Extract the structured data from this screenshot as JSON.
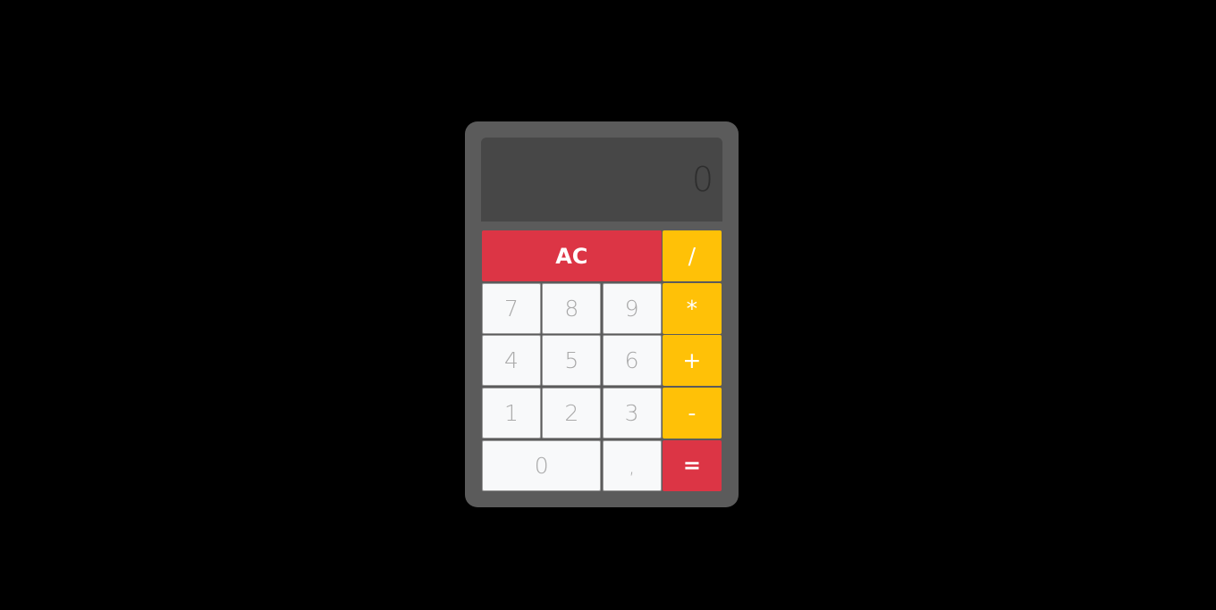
{
  "calculator": {
    "display_value": "0",
    "keys": {
      "clear": "AC",
      "divide": "/",
      "multiply": "*",
      "add": "+",
      "subtract": "-",
      "equals": "=",
      "seven": "7",
      "eight": "8",
      "nine": "9",
      "four": "4",
      "five": "5",
      "six": "6",
      "one": "1",
      "two": "2",
      "three": "3",
      "zero": "0",
      "decimal": ","
    }
  },
  "colors": {
    "background": "#000000",
    "body": "#5b5b5b",
    "display": "#474747",
    "number_key": "#f8f9fa",
    "operator_key": "#ffc107",
    "danger_key": "#dc3545"
  }
}
